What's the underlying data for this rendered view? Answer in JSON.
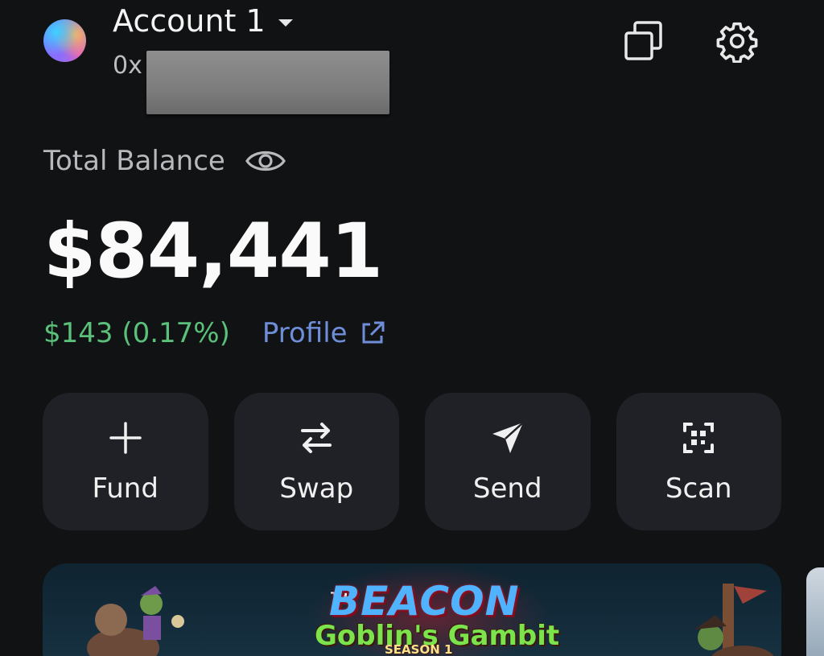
{
  "header": {
    "account_name": "Account 1",
    "address_prefix": "0x"
  },
  "balance": {
    "label": "Total Balance",
    "amount": "$84,441",
    "change": "$143 (0.17%)",
    "profile_label": "Profile"
  },
  "actions": [
    {
      "label": "Fund",
      "icon": "plus-icon"
    },
    {
      "label": "Swap",
      "icon": "swap-arrows-icon"
    },
    {
      "label": "Send",
      "icon": "send-arrow-icon"
    },
    {
      "label": "Scan",
      "icon": "qr-scan-icon"
    }
  ],
  "banner": {
    "the": "THE",
    "title": "BEACON",
    "subtitle": "Goblin's Gambit",
    "season": "SEASON 1"
  },
  "colors": {
    "background": "#111214",
    "button_bg": "#1f2126",
    "positive": "#5ac07a",
    "link": "#6f8ed9"
  }
}
